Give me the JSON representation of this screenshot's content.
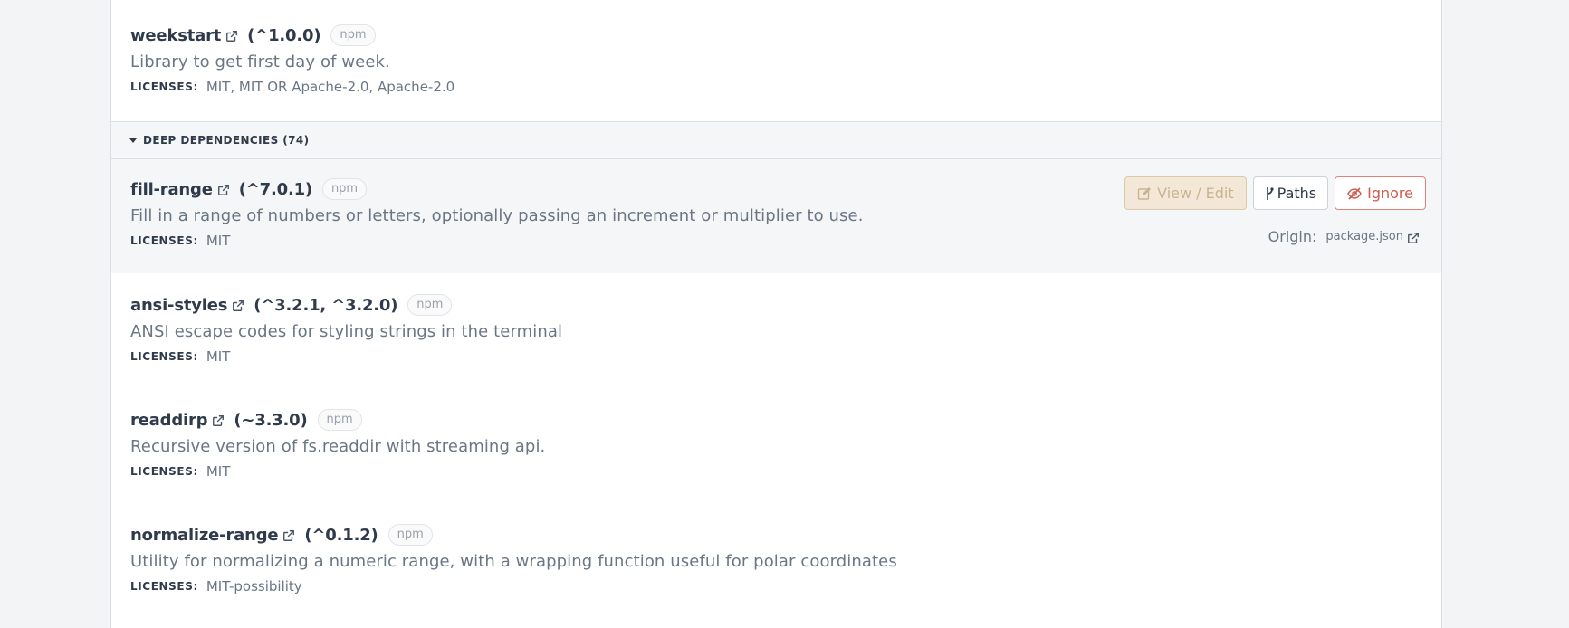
{
  "deps_top": [
    {
      "name": "weekstart",
      "version": "(^1.0.0)",
      "badge": "npm",
      "description": "Library to get first day of week.",
      "licenses_label": "LICENSES:",
      "licenses": "MIT, MIT OR Apache-2.0, Apache-2.0"
    }
  ],
  "section": {
    "label": "DEEP DEPENDENCIES (74)"
  },
  "deps": [
    {
      "name": "fill-range",
      "version": "(^7.0.1)",
      "badge": "npm",
      "description": "Fill in a range of numbers or letters, optionally passing an increment or multiplier to use.",
      "licenses_label": "LICENSES:",
      "licenses": "MIT",
      "actions": {
        "view_edit": "View / Edit",
        "paths": "Paths",
        "ignore": "Ignore"
      },
      "origin_label": "Origin:",
      "origin_link": "package.json"
    },
    {
      "name": "ansi-styles",
      "version": "(^3.2.1, ^3.2.0)",
      "badge": "npm",
      "description": "ANSI escape codes for styling strings in the terminal",
      "licenses_label": "LICENSES:",
      "licenses": "MIT"
    },
    {
      "name": "readdirp",
      "version": "(~3.3.0)",
      "badge": "npm",
      "description": "Recursive version of fs.readdir with streaming api.",
      "licenses_label": "LICENSES:",
      "licenses": "MIT"
    },
    {
      "name": "normalize-range",
      "version": "(^0.1.2)",
      "badge": "npm",
      "description": "Utility for normalizing a numeric range, with a wrapping function useful for polar coordinates",
      "licenses_label": "LICENSES:",
      "licenses": "MIT-possibility"
    }
  ],
  "icons": {
    "external": "external-link-icon",
    "edit": "edit-icon",
    "paths": "branch-icon",
    "ignore": "eye-slash-icon"
  },
  "colors": {
    "ignore": "#d05a4c",
    "view_edit_bg": "#f3e8d7"
  }
}
